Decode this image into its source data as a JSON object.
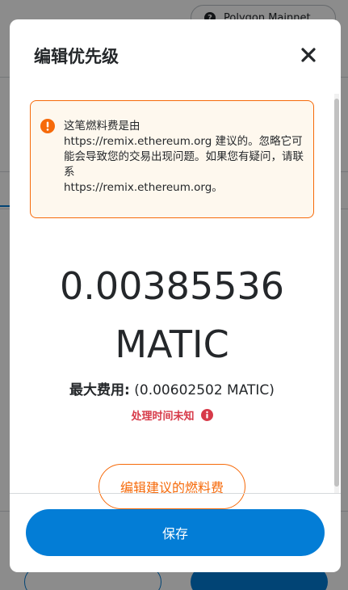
{
  "background": {
    "network_label": "Polygon Mainnet"
  },
  "modal": {
    "title": "编辑优先级",
    "warning": {
      "text": "这笔燃料费是由\nhttps://remix.ethereum.org 建议的。忽略它可能会导致您的交易出现问题。如果您有疑问，请联系\nhttps://remix.ethereum.org。"
    },
    "amount_value": "0.00385536",
    "amount_unit": "MATIC",
    "max_fee_label": "最大费用:",
    "max_fee_value": "(0.00602502 MATIC)",
    "processing_time": "处理时间未知",
    "edit_suggested_label": "编辑建议的燃料费",
    "save_label": "保存"
  },
  "colors": {
    "primary": "#037dd6",
    "warning": "#f66a0a",
    "error": "#d73a49"
  }
}
